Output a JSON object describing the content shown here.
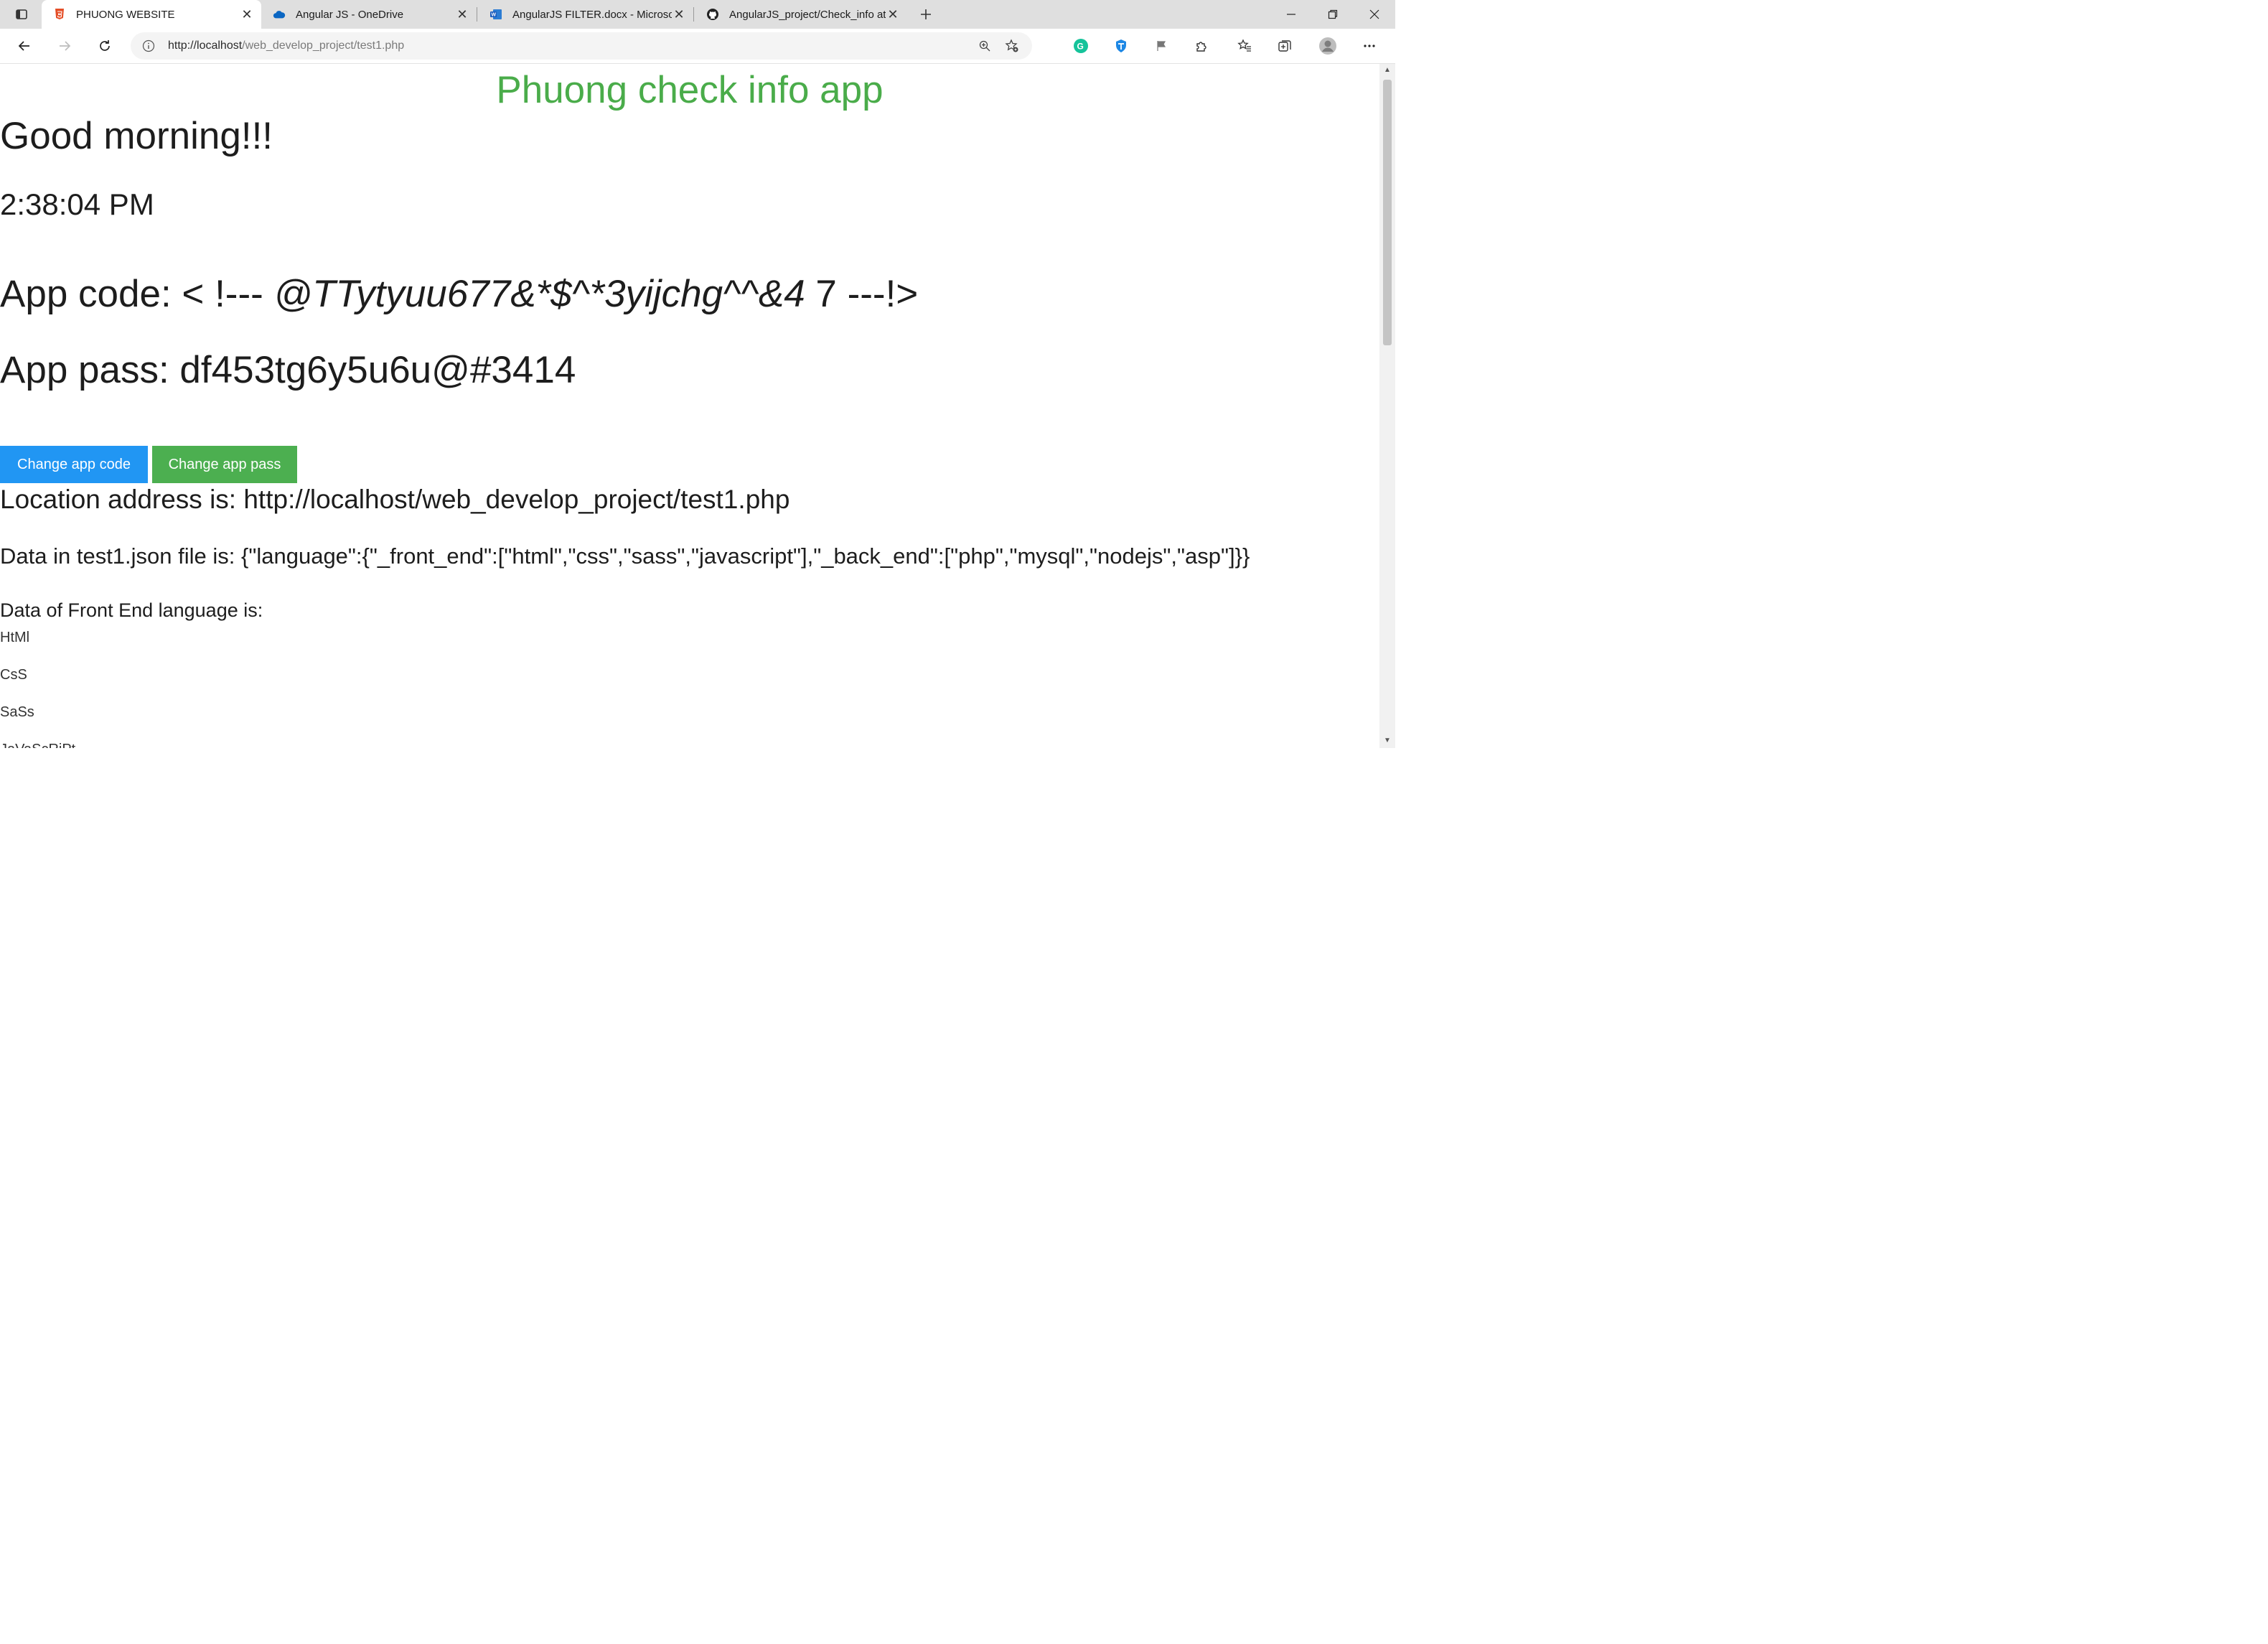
{
  "browser": {
    "tabs": [
      {
        "title": "PHUONG WEBSITE",
        "icon": "html5-icon",
        "active": true
      },
      {
        "title": "Angular JS - OneDrive",
        "icon": "onedrive-icon",
        "active": false
      },
      {
        "title": "AngularJS FILTER.docx - Microsoft",
        "icon": "word-icon",
        "active": false
      },
      {
        "title": "AngularJS_project/Check_info at",
        "icon": "github-icon",
        "active": false
      }
    ],
    "url_host": "http://localhost",
    "url_path": "/web_develop_project/test1.php",
    "accent_color": "#4aac4a"
  },
  "page": {
    "heading": "Phuong check info app",
    "greeting": "Good morning!!!",
    "time": "2:38:04 PM",
    "app_code_label": "App code: < !--- ",
    "app_code_italic": "@TTytyuu677&*$^*3yijchg^^&4",
    "app_code_tail": " 7 ---!>",
    "app_pass": "App pass: df453tg6y5u6u@#3414",
    "change_code_button": "Change app code",
    "change_pass_button": "Change app pass",
    "location": "Location address is: http://localhost/web_develop_project/test1.php",
    "json_line": "Data in test1.json file is: {\"language\":{\"_front_end\":[\"html\",\"css\",\"sass\",\"javascript\"],\"_back_end\":[\"php\",\"mysql\",\"nodejs\",\"asp\"]}}",
    "front_end_title": "Data of Front End language is:",
    "front_end_items": [
      "HtMl",
      "CsS",
      "SaSs",
      "JaVaScRiPt"
    ]
  }
}
